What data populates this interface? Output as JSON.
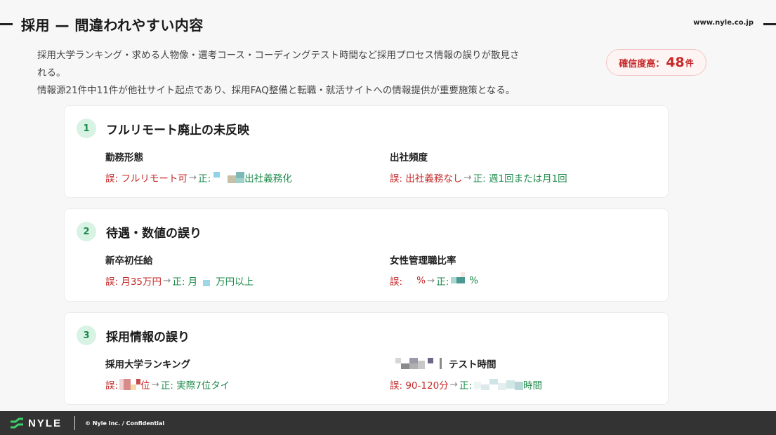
{
  "header": {
    "title": "採用 — 間違われやすい内容",
    "site_url": "www.nyle.co.jp"
  },
  "summary": {
    "line1": "採用大学ランキング・求める人物像・選考コース・コーディングテスト時間など採用プロセス情報の誤りが散見さ",
    "line2": "れる。",
    "line3": "情報源21件中11件が他社サイト起点であり、採用FAQ整備と転職・就活サイトへの情報提供が重要施策となる。"
  },
  "confidence": {
    "label": "確信度高：",
    "value": "48",
    "unit": "件"
  },
  "cards": [
    {
      "number": "1",
      "title": "フルリモート廃止の未反映",
      "items": [
        {
          "label": "勤務形態",
          "err": "誤: フルリモート可",
          "arrow": "→",
          "ok_prefix": "正:",
          "ok_suffix": "出社義務化"
        },
        {
          "label": "出社頻度",
          "err": "誤: 出社義務なし",
          "arrow": "→",
          "ok_prefix": "正: 週1回または月1回",
          "ok_suffix": ""
        }
      ]
    },
    {
      "number": "2",
      "title": "待遇・数値の誤り",
      "items": [
        {
          "label": "新卒初任給",
          "err": "誤: 月35万円",
          "arrow": "→",
          "ok_prefix": "正: 月",
          "ok_suffix": "万円以上"
        },
        {
          "label": "女性管理職比率",
          "err": "誤:",
          "err_suffix": "%",
          "arrow": "→",
          "ok_prefix": "正:",
          "ok_suffix": "%"
        }
      ]
    },
    {
      "number": "3",
      "title": "採用情報の誤り",
      "items": [
        {
          "label": "採用大学ランキング",
          "err": "誤:",
          "err_suffix": "位",
          "arrow": "→",
          "ok_prefix": "正: 実際7位タイ",
          "ok_suffix": ""
        },
        {
          "label": "テスト時間",
          "err": "誤: 90-120分",
          "arrow": "→",
          "ok_prefix": "正:",
          "ok_suffix": "時間"
        }
      ]
    }
  ],
  "footer": {
    "logo_text": "NYLE",
    "copyright": "© Nyle Inc. / Confidential"
  },
  "colors": {
    "error": "#c62828",
    "correct": "#1c8a4a",
    "badge_bg": "#d8f3e3",
    "footer_bg": "#333333"
  }
}
